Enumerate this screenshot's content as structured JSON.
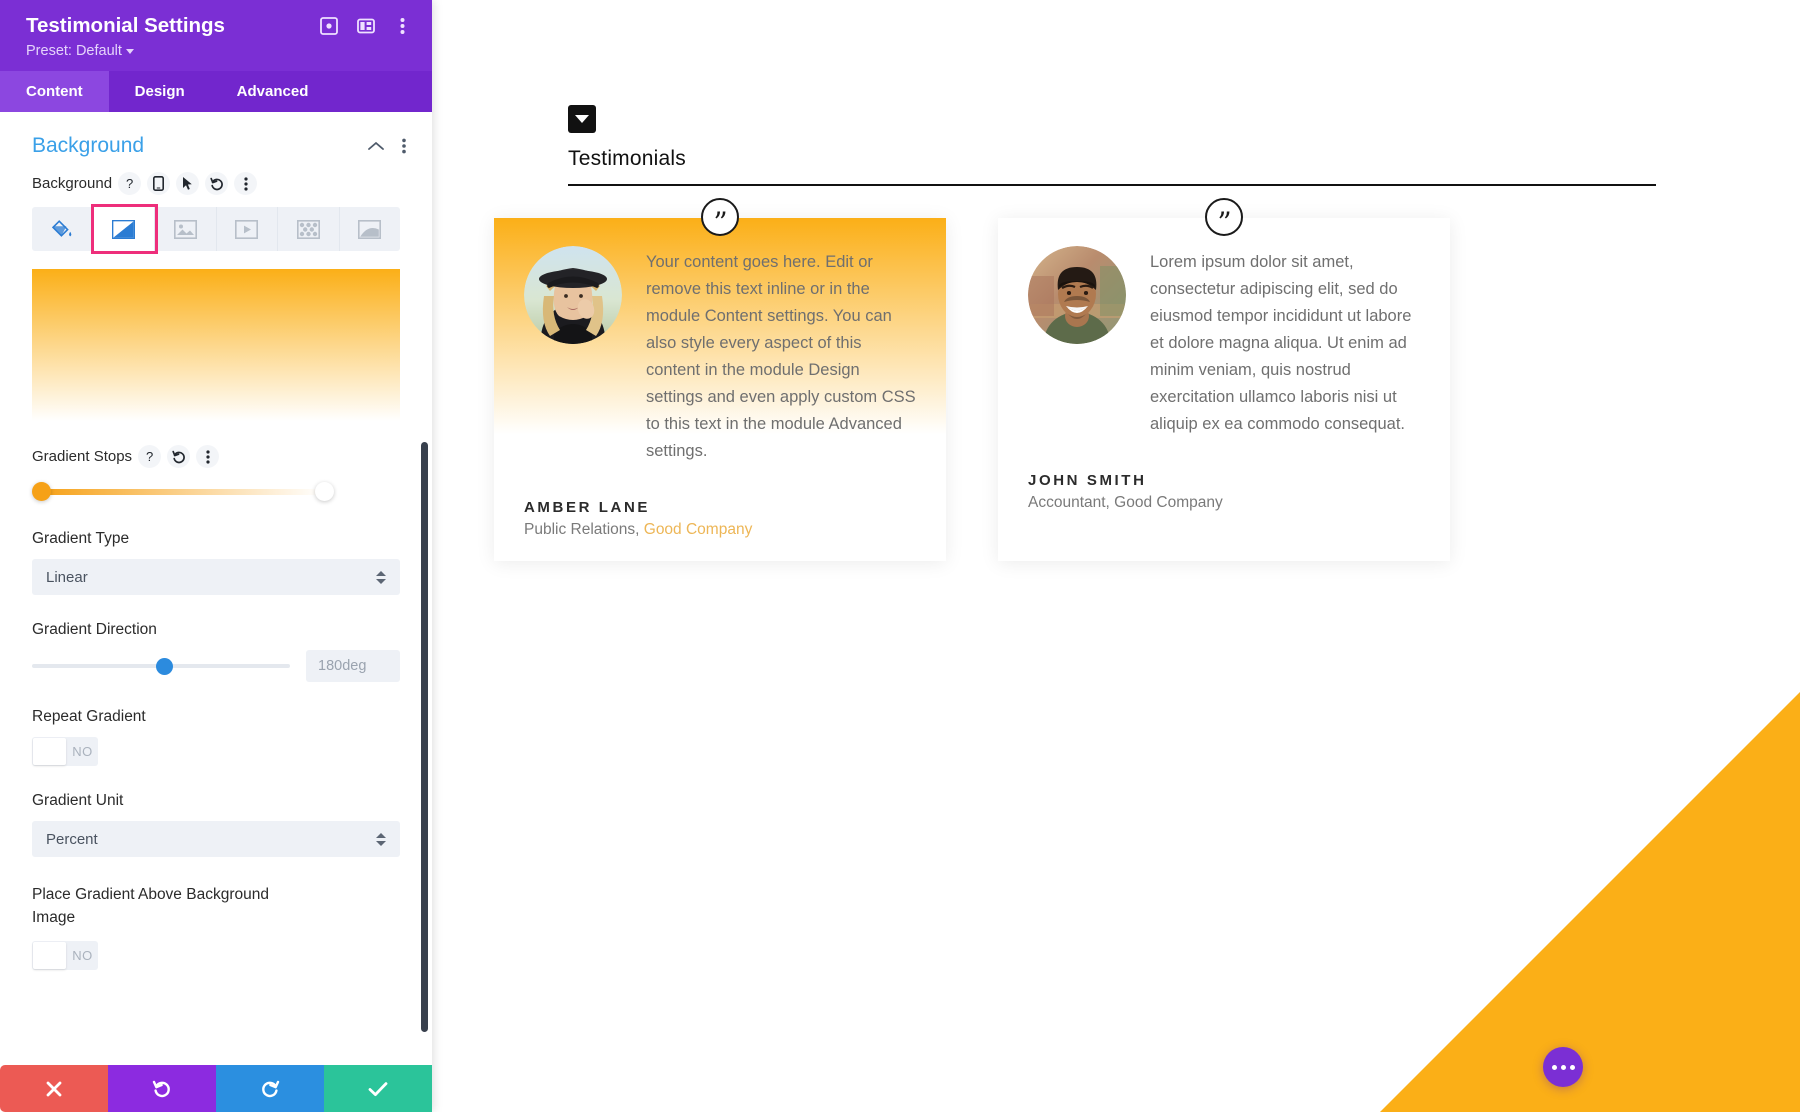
{
  "panel": {
    "title": "Testimonial Settings",
    "preset_label": "Preset: Default",
    "header_icons": [
      "focus-icon",
      "layout-icon",
      "kebab-icon"
    ],
    "tabs": [
      {
        "label": "Content",
        "active": true
      },
      {
        "label": "Design",
        "active": false
      },
      {
        "label": "Advanced",
        "active": false
      }
    ],
    "group": {
      "title": "Background",
      "collapse_icon": "chevron-up-icon",
      "kebab_icon": "kebab-icon"
    },
    "background_field": {
      "label": "Background",
      "controls": [
        "help-icon",
        "responsive-icon",
        "hover-icon",
        "reset-icon",
        "kebab-icon"
      ],
      "types": [
        {
          "name": "color",
          "selected": false
        },
        {
          "name": "gradient",
          "selected": true
        },
        {
          "name": "image",
          "selected": false
        },
        {
          "name": "video",
          "selected": false
        },
        {
          "name": "pattern",
          "selected": false
        },
        {
          "name": "mask",
          "selected": false
        }
      ],
      "selected_outline_color": "#EE2E7B"
    },
    "gradient_preview": {
      "start_color": "#FBAF17",
      "end_color": "#FFFFFF"
    },
    "gradient_stops": {
      "label": "Gradient Stops",
      "controls": [
        "help-icon",
        "reset-icon",
        "kebab-icon"
      ],
      "stops": [
        {
          "position": 0,
          "color": "#F6A117"
        },
        {
          "position": 100,
          "color": "#FFFFFF"
        }
      ]
    },
    "gradient_type": {
      "label": "Gradient Type",
      "value": "Linear"
    },
    "gradient_direction": {
      "label": "Gradient Direction",
      "value": "180deg",
      "slider_percent": 48
    },
    "repeat_gradient": {
      "label": "Repeat Gradient",
      "value": "NO"
    },
    "gradient_unit": {
      "label": "Gradient Unit",
      "value": "Percent"
    },
    "place_above": {
      "label": "Place Gradient Above Background Image",
      "value": "NO"
    },
    "footer": [
      {
        "name": "cancel",
        "glyph": "✕"
      },
      {
        "name": "undo",
        "glyph": "↺"
      },
      {
        "name": "redo",
        "glyph": "↻"
      },
      {
        "name": "save",
        "glyph": "✓"
      }
    ]
  },
  "preview": {
    "section": {
      "title": "Testimonials",
      "collapse_icon": "caret-down-icon"
    },
    "testimonials": [
      {
        "quote_icon": "quotation-mark-icon",
        "quote": "Your content goes here. Edit or remove this text inline or in the module Content settings. You can also style every aspect of this content in the module Design settings and even apply custom CSS to this text in the module Advanced settings.",
        "author": "AMBER LANE",
        "role_prefix": "Public Relations,",
        "company": " Good Company",
        "has_gradient_background": true,
        "avatar": "woman-in-hat-portrait"
      },
      {
        "quote_icon": "quotation-mark-icon",
        "quote": "Lorem ipsum dolor sit amet, consectetur adipiscing elit, sed do eiusmod tempor incididunt ut labore et dolore magna aliqua. Ut enim ad minim veniam, quis nostrud exercitation ullamco laboris nisi ut aliquip ex ea commodo consequat.",
        "author": "JOHN SMITH",
        "role_prefix": "Accountant, Good Company",
        "company": "",
        "has_gradient_background": false,
        "avatar": "smiling-man-portrait"
      }
    ],
    "fab": {
      "name": "more-options-button",
      "color": "#7B2FD4"
    },
    "accent_color": "#FBAF17"
  }
}
